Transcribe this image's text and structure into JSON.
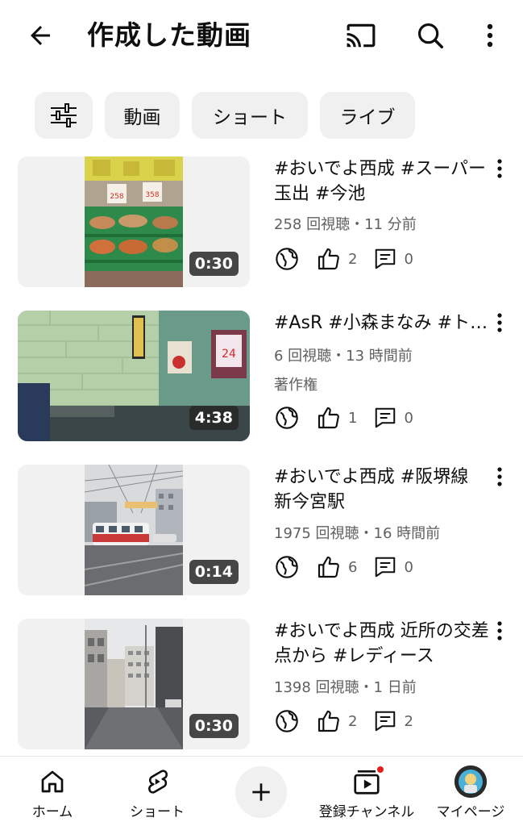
{
  "header": {
    "title": "作成した動画",
    "icons": [
      "back-arrow-icon",
      "cast-icon",
      "search-icon",
      "more-vert-icon"
    ]
  },
  "chips": {
    "filter_icon": "tune-icon",
    "items": [
      "動画",
      "ショート",
      "ライブ"
    ]
  },
  "videos": [
    {
      "title": "#おいでよ西成 #スーパー玉出 #今池",
      "meta": "258 回視聴・11 分前",
      "extra": "",
      "duration": "0:30",
      "likes": "2",
      "comments": "0"
    },
    {
      "title": "#AsR #小森まなみ #トーストを作ろうよ",
      "meta": "6 回視聴・13 時間前",
      "extra": "著作権",
      "duration": "4:38",
      "likes": "1",
      "comments": "0"
    },
    {
      "title": "#おいでよ西成 #阪堺線 新今宮駅",
      "meta": "1975 回視聴・16 時間前",
      "extra": "",
      "duration": "0:14",
      "likes": "6",
      "comments": "0"
    },
    {
      "title": "#おいでよ西成 近所の交差点から #レディース",
      "meta": "1398 回視聴・1 日前",
      "extra": "",
      "duration": "0:30",
      "likes": "2",
      "comments": "2"
    }
  ],
  "bottom_nav": {
    "items": [
      {
        "label": "ホーム",
        "icon": "home-icon"
      },
      {
        "label": "ショート",
        "icon": "shorts-icon"
      },
      {
        "label": "",
        "icon": "create-plus-icon"
      },
      {
        "label": "登録チャンネル",
        "icon": "subscriptions-icon"
      },
      {
        "label": "マイページ",
        "icon": "avatar"
      }
    ]
  },
  "colors": {
    "text": "#0f0f0f",
    "secondary": "#606060",
    "chip_bg": "#f0f0f0",
    "badge": "#e02020"
  }
}
